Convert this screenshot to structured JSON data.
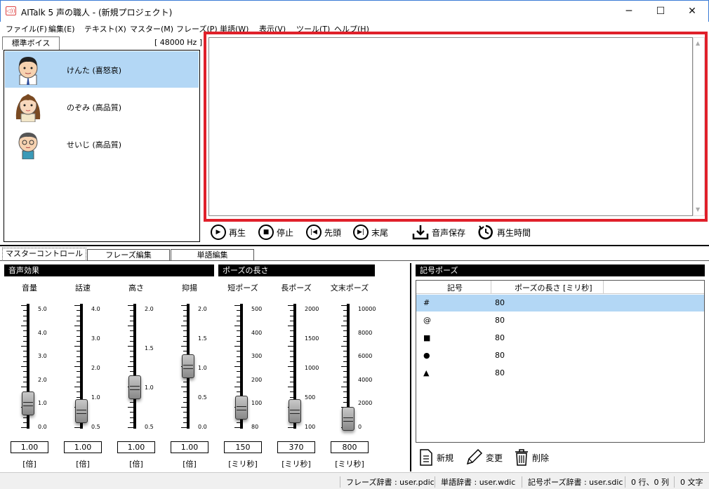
{
  "window": {
    "title": "AITalk 5 声の職人 - (新規プロジェクト)",
    "app_icon_glyph": "◁))",
    "minimize_glyph": "─",
    "maximize_glyph": "☐",
    "close_glyph": "✕"
  },
  "menu": [
    "ファイル(F)",
    "編集(E)",
    "テキスト(X)",
    "マスター(M)",
    "フレーズ(P)",
    "単語(W)",
    "表示(V)",
    "ツール(T)",
    "ヘルプ(H)"
  ],
  "voice_panel": {
    "tab_label": "標準ボイス",
    "sample_rate": "[ 48000 Hz ]",
    "voices": [
      {
        "name": "けんた (喜怒哀)",
        "selected": true
      },
      {
        "name": "のぞみ (高品質)",
        "selected": false
      },
      {
        "name": "せいじ (高品質)",
        "selected": false
      }
    ]
  },
  "editor": {
    "text": "",
    "highlight_color": "#e0202a"
  },
  "playback": {
    "play": "再生",
    "stop": "停止",
    "head": "先頭",
    "tail": "末尾",
    "save_audio": "音声保存",
    "play_time": "再生時間"
  },
  "bottom_tabs": [
    "マスターコントロール",
    "フレーズ編集",
    "単語編集"
  ],
  "sections": {
    "voice_effect": "音声効果",
    "pause_length": "ポーズの長さ",
    "symbol_pause": "記号ポーズ"
  },
  "sliders": [
    {
      "label": "音量",
      "value": "1.00",
      "unit": "[倍]",
      "min": 0,
      "max": 5,
      "level": 0.2,
      "scale": [
        "5.0",
        "4.0",
        "3.0",
        "2.0",
        "1.0",
        "0.0"
      ]
    },
    {
      "label": "話速",
      "value": "1.00",
      "unit": "[倍]",
      "min": 0.5,
      "max": 4,
      "level": 0.143,
      "scale": [
        "4.0",
        "3.0",
        "2.0",
        "1.0",
        "0.5"
      ]
    },
    {
      "label": "高さ",
      "value": "1.00",
      "unit": "[倍]",
      "min": 0.5,
      "max": 2,
      "level": 0.333,
      "scale": [
        "2.0",
        "1.5",
        "1.0",
        "0.5"
      ]
    },
    {
      "label": "抑揚",
      "value": "1.00",
      "unit": "[倍]",
      "min": 0,
      "max": 2,
      "level": 0.5,
      "scale": [
        "2.0",
        "1.5",
        "1.0",
        "0.5",
        "0.0"
      ]
    },
    {
      "label": "短ポーズ",
      "value": "150",
      "unit": "[ミリ秒]",
      "min": 80,
      "max": 500,
      "level": 0.167,
      "scale": [
        "500",
        "400",
        "300",
        "200",
        "100",
        "80"
      ]
    },
    {
      "label": "長ポーズ",
      "value": "370",
      "unit": "[ミリ秒]",
      "min": 100,
      "max": 2000,
      "level": 0.142,
      "scale": [
        "2000",
        "1500",
        "1000",
        "500",
        "100"
      ]
    },
    {
      "label": "文末ポーズ",
      "value": "800",
      "unit": "[ミリ秒]",
      "min": 0,
      "max": 10000,
      "level": 0.08,
      "scale": [
        "10000",
        "8000",
        "6000",
        "4000",
        "2000",
        "0"
      ]
    }
  ],
  "symbol_pause_table": {
    "headers": [
      "記号",
      "ポーズの長さ [ミリ秒]"
    ],
    "rows": [
      {
        "symbol": "#",
        "length": "80",
        "selected": true
      },
      {
        "symbol": "@",
        "length": "80",
        "selected": false
      },
      {
        "symbol": "■",
        "length": "80",
        "selected": false
      },
      {
        "symbol": "●",
        "length": "80",
        "selected": false
      },
      {
        "symbol": "▲",
        "length": "80",
        "selected": false
      }
    ],
    "buttons": {
      "new": "新規",
      "edit": "変更",
      "delete": "削除"
    }
  },
  "status": {
    "phrase_dict": "フレーズ辞書 : user.pdic",
    "word_dict": "単語辞書 : user.wdic",
    "symbol_dict": "記号ポーズ辞書 : user.sdic",
    "cursor": "0 行、0 列",
    "chars": "0 文字"
  }
}
